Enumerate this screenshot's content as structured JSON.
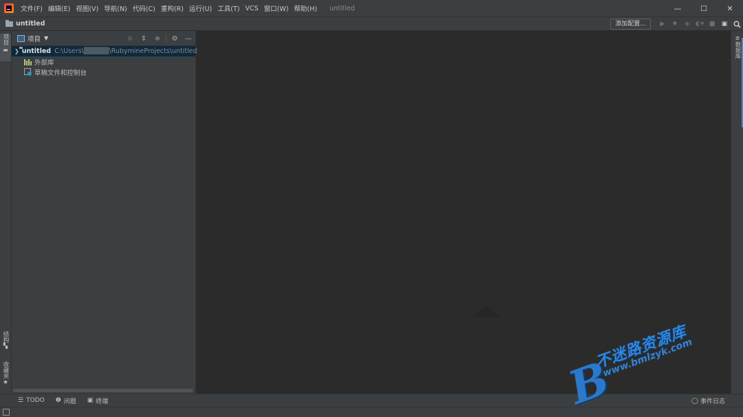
{
  "menu": {
    "items": [
      "文件(F)",
      "编辑(E)",
      "视图(V)",
      "导航(N)",
      "代码(C)",
      "重构(R)",
      "运行(U)",
      "工具(T)",
      "VCS",
      "窗口(W)",
      "帮助(H)"
    ],
    "window_title": "untitled"
  },
  "window_controls": {
    "minimize": "—",
    "maximize": "☐",
    "close": "✕"
  },
  "navbar": {
    "project_name": "untitled",
    "add_config_label": "添加配置...",
    "toolbar_icons": [
      "run-icon",
      "debug-icon",
      "coverage-icon",
      "profile-icon",
      "stop-icon",
      "layout-icon",
      "search-icon"
    ]
  },
  "left_stripe": {
    "project_tab": "项目",
    "structure_tab": "结构",
    "favorites_tab": "收藏夹"
  },
  "right_stripe": {
    "database_tab": "数据库"
  },
  "project_panel": {
    "title": "项目",
    "tree": {
      "root_name": "untitled",
      "root_path": "C:\\Users\\▒▒▒▒▒\\RubymineProjects\\untitled",
      "external_libs": "外部库",
      "scratches": "草稿文件和控制台"
    }
  },
  "bottom_bar": {
    "todo": "TODO",
    "problems": "问题",
    "terminal": "终端",
    "event_log": "事件日志"
  },
  "watermark": {
    "logo_letter": "B",
    "name": "不迷路资源库",
    "url": "www.bmlzyk.com"
  },
  "colors": {
    "background": "#2b2b2b",
    "chrome": "#3c3f41",
    "selection": "#0d293e",
    "accent": "#4a88c7",
    "watermark": "#2f86dd"
  }
}
